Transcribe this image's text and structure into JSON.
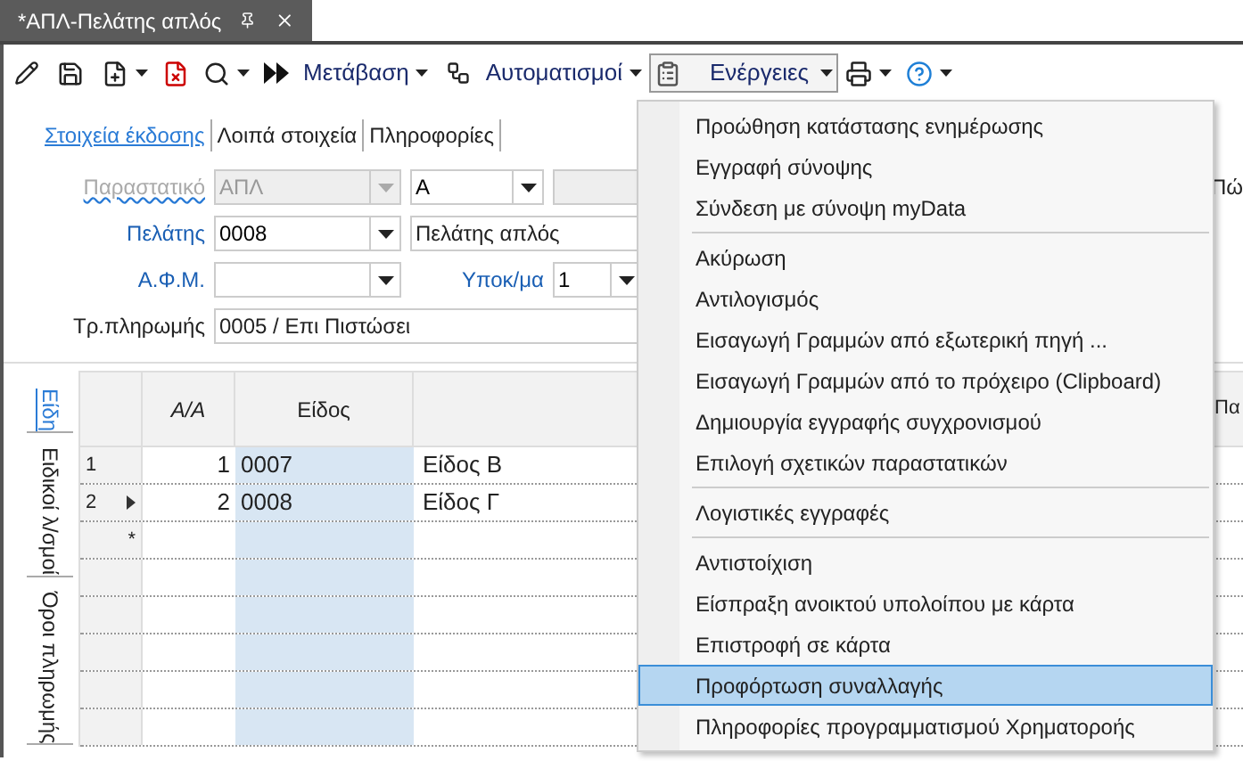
{
  "document_tab": {
    "title": "*ΑΠΛ-Πελάτης απλός"
  },
  "toolbar": {
    "goto": "Μετάβαση",
    "automation": "Αυτοματισμοί",
    "actions": {
      "label": "Ενέργειες",
      "open": true
    }
  },
  "form_tabs": [
    {
      "label": "Στοιχεία έκδοσης",
      "selected": true
    },
    {
      "label": "Λοιπά στοιχεία",
      "selected": false
    },
    {
      "label": "Πληροφορίες",
      "selected": false
    }
  ],
  "fields": {
    "document": {
      "label": "Παραστατικό",
      "disabled": true,
      "value": "ΑΠΛ",
      "series": "Α"
    },
    "customer": {
      "label": "Πελάτης",
      "code": "0008",
      "name": "Πελάτης απλός"
    },
    "vat": {
      "label": "Α.Φ.Μ."
    },
    "branch": {
      "label": "Υποκ/μα",
      "value": "1"
    },
    "payment": {
      "label": "Τρ.πληρωμής",
      "value": "0005 / Επι Πιστώσει"
    },
    "right_label_cut": "Πώ"
  },
  "side_tabs": [
    {
      "label": "Είδη",
      "selected": true
    },
    {
      "label": "Ειδικοί λ/σμοί",
      "selected": false
    },
    {
      "label": "Όροι πληρωμής",
      "selected": false
    }
  ],
  "grid": {
    "columns": [
      "Α/Α",
      "Είδος"
    ],
    "column_cut": "Πα",
    "new_row_marker": "*",
    "rows": [
      {
        "number": "1",
        "current": false,
        "aa": "1",
        "code": "0007",
        "name": "Είδος Β"
      },
      {
        "number": "2",
        "current": true,
        "aa": "2",
        "code": "0008",
        "name": "Είδος Γ"
      }
    ]
  },
  "menu_groups": [
    [
      {
        "label": "Προώθηση κατάστασης ενημέρωσης",
        "selected": false
      },
      {
        "label": "Εγγραφή σύνοψης",
        "selected": false
      },
      {
        "label": "Σύνδεση με σύνοψη myData",
        "selected": false
      }
    ],
    [
      {
        "label": "Ακύρωση",
        "selected": false
      },
      {
        "label": "Αντιλογισμός",
        "selected": false
      },
      {
        "label": "Εισαγωγή Γραμμών από εξωτερική πηγή ...",
        "selected": false
      },
      {
        "label": "Εισαγωγή Γραμμών από το πρόχειρο (Clipboard)",
        "selected": false
      },
      {
        "label": "Δημιουργία εγγραφής συγχρονισμού",
        "selected": false
      },
      {
        "label": "Επιλογή σχετικών παραστατικών",
        "selected": false
      }
    ],
    [
      {
        "label": "Λογιστικές εγγραφές",
        "selected": false
      }
    ],
    [
      {
        "label": "Αντιστοίχιση",
        "selected": false
      },
      {
        "label": "Είσπραξη ανοικτού υπολοίπου με κάρτα",
        "selected": false
      },
      {
        "label": "Επιστροφή σε κάρτα",
        "selected": false
      },
      {
        "label": "Προφόρτωση συναλλαγής",
        "selected": true
      },
      {
        "label": "Πληροφορίες προγραμματισμού Χρηματοροής",
        "selected": false
      }
    ]
  ]
}
